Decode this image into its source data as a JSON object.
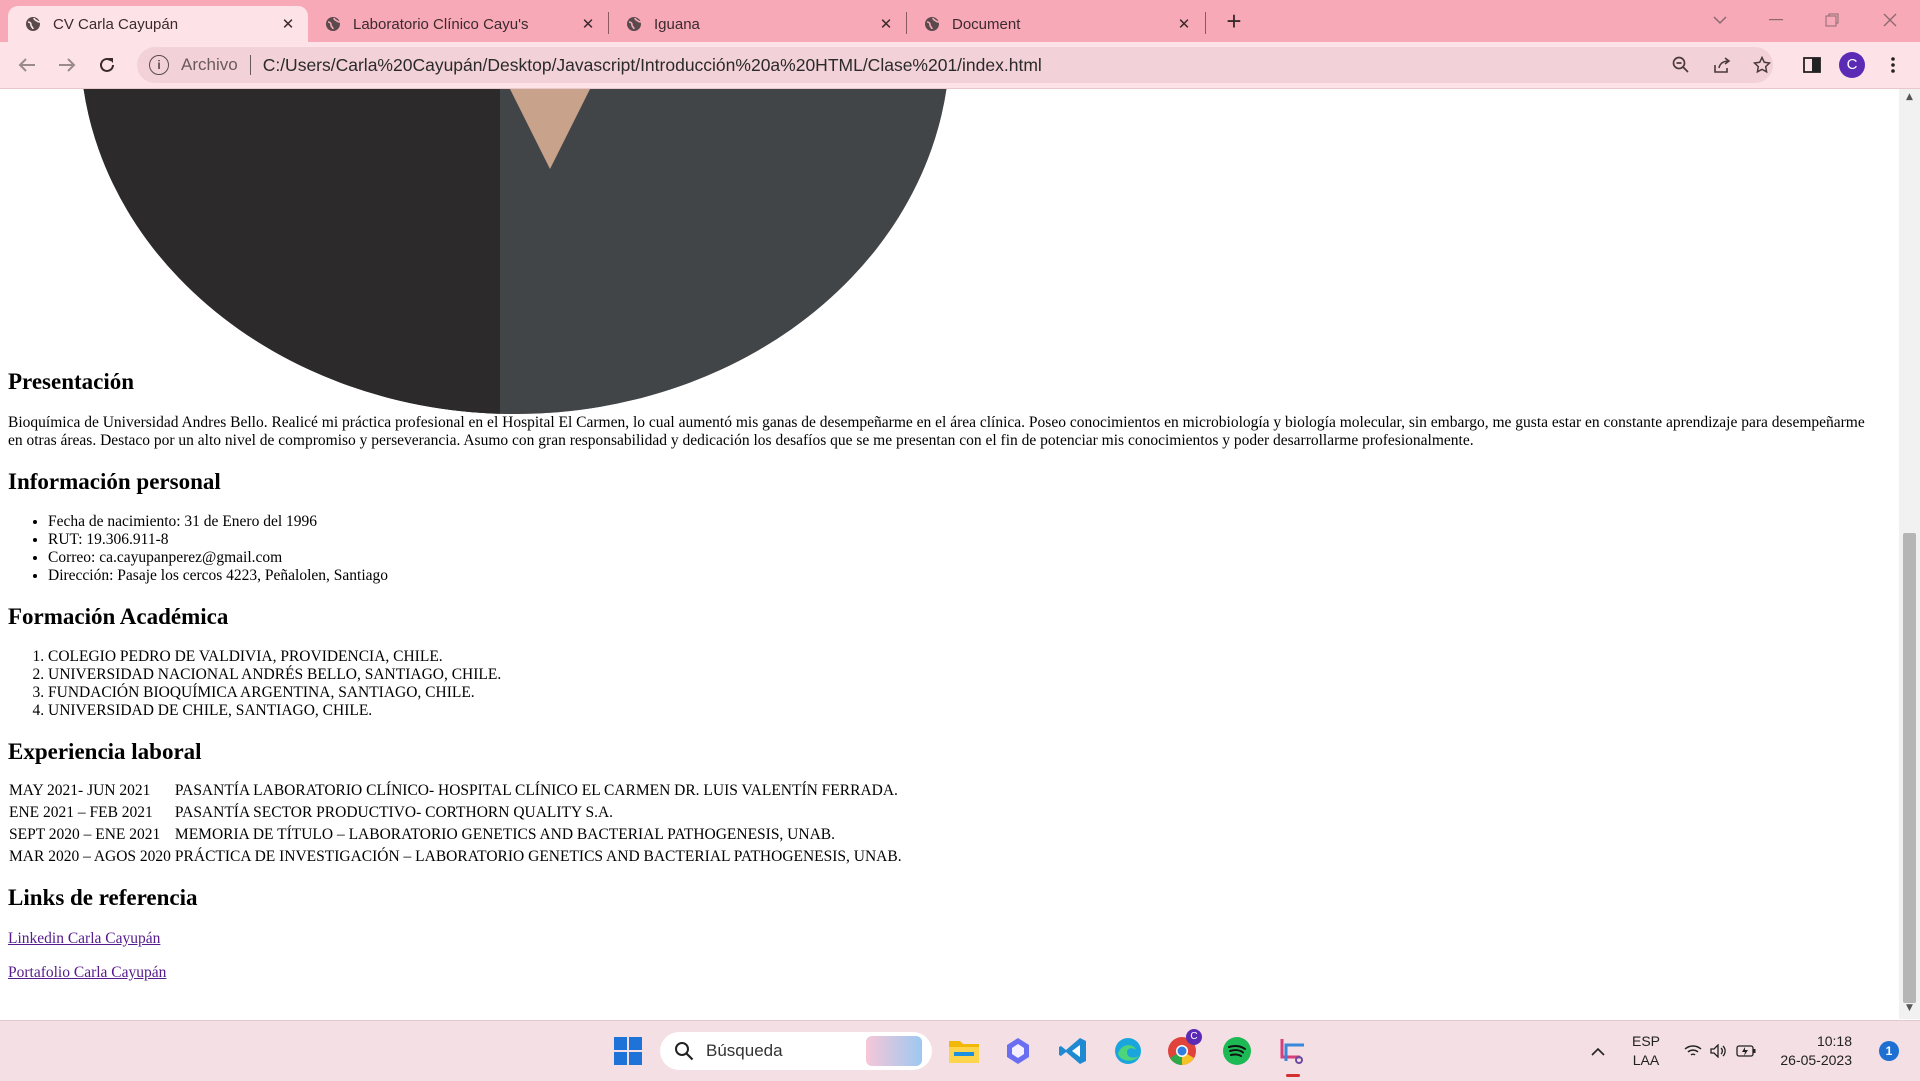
{
  "browser": {
    "tabs": [
      {
        "label": "CV Carla Cayupán",
        "active": true
      },
      {
        "label": "Laboratorio Clínico Cayu's",
        "active": false
      },
      {
        "label": "Iguana",
        "active": false
      },
      {
        "label": "Document",
        "active": false
      }
    ],
    "address": {
      "scheme_label": "Archivo",
      "url": "C:/Users/Carla%20Cayupán/Desktop/Javascript/Introducción%20a%20HTML/Clase%201/index.html"
    },
    "profile_initial": "C"
  },
  "page": {
    "presentacion": {
      "heading": "Presentación",
      "text": "Bioquímica de Universidad Andres Bello. Realicé mi práctica profesional en el Hospital El Carmen, lo cual aumentó mis ganas de desempeñarme en el área clínica. Poseo conocimientos en microbiología y biología molecular, sin embargo, me gusta estar en constante aprendizaje para desempeñarme en otras áreas. Destaco por un alto nivel de compromiso y perseverancia. Asumo con gran responsabilidad y dedicación los desafíos que se me presentan con el fin de potenciar mis conocimientos y poder desarrollarme profesionalmente."
    },
    "personal": {
      "heading": "Información personal",
      "items": [
        "Fecha de nacimiento: 31 de Enero del 1996",
        "RUT: 19.306.911-8",
        "Correo: ca.cayupanperez@gmail.com",
        "Dirección: Pasaje los cercos 4223, Peñalolen, Santiago"
      ]
    },
    "formacion": {
      "heading": "Formación Académica",
      "items": [
        "COLEGIO PEDRO DE VALDIVIA, PROVIDENCIA, CHILE.",
        "UNIVERSIDAD NACIONAL ANDRÉS BELLO, SANTIAGO, CHILE.",
        "FUNDACIÓN BIOQUÍMICA ARGENTINA, SANTIAGO, CHILE.",
        "UNIVERSIDAD DE CHILE, SANTIAGO, CHILE."
      ]
    },
    "experiencia": {
      "heading": "Experiencia laboral",
      "rows": [
        {
          "period": "MAY 2021- JUN 2021",
          "desc": "PASANTÍA LABORATORIO CLÍNICO- HOSPITAL CLÍNICO EL CARMEN DR. LUIS VALENTÍN FERRADA."
        },
        {
          "period": "ENE 2021 – FEB 2021",
          "desc": "PASANTÍA SECTOR PRODUCTIVO- CORTHORN QUALITY S.A."
        },
        {
          "period": "SEPT 2020 – ENE 2021",
          "desc": "MEMORIA DE TÍTULO – LABORATORIO GENETICS AND BACTERIAL PATHOGENESIS, UNAB."
        },
        {
          "period": "MAR 2020 – AGOS 2020",
          "desc": "PRÁCTICA DE INVESTIGACIÓN – LABORATORIO GENETICS AND BACTERIAL PATHOGENESIS, UNAB."
        }
      ]
    },
    "links": {
      "heading": "Links de referencia",
      "items": [
        "Linkedin Carla Cayupán",
        "Portafolio Carla Cayupán"
      ]
    }
  },
  "taskbar": {
    "search_placeholder": "Búsqueda",
    "chrome_badge": "C",
    "language": "ESP",
    "layout": "LAA",
    "time": "10:18",
    "date": "26-05-2023",
    "notification_count": "1"
  }
}
